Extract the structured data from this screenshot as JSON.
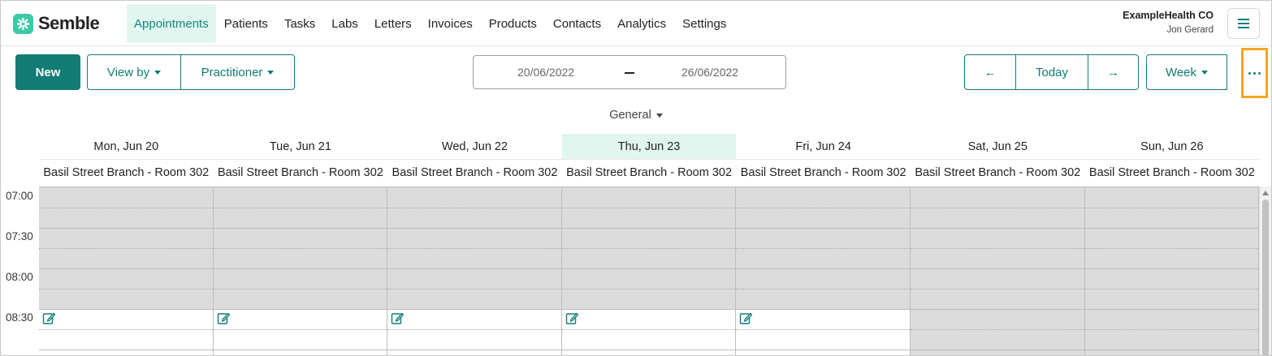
{
  "app": {
    "logo_text": "Semble",
    "brand_color": "#127c74",
    "accent_mint": "#3ec9a7",
    "highlight_color": "#f5a623"
  },
  "nav": {
    "items": [
      {
        "label": "Appointments",
        "active": true
      },
      {
        "label": "Patients"
      },
      {
        "label": "Tasks"
      },
      {
        "label": "Labs"
      },
      {
        "label": "Letters"
      },
      {
        "label": "Invoices"
      },
      {
        "label": "Products"
      },
      {
        "label": "Contacts"
      },
      {
        "label": "Analytics"
      },
      {
        "label": "Settings"
      }
    ],
    "org_name": "ExampleHealth CO",
    "user_name": "Jon Gerard",
    "menu_icon": "hamburger-icon"
  },
  "toolbar": {
    "new_label": "New",
    "view_by_label": "View by",
    "practitioner_label": "Practitioner",
    "date_from": "20/06/2022",
    "date_to": "26/06/2022",
    "prev_label": "←",
    "today_label": "Today",
    "next_label": "→",
    "range_label": "Week",
    "more_icon": "more-horizontal-icon"
  },
  "calendar": {
    "resource_filter": "General",
    "days": [
      {
        "name": "Mon, Jun 20",
        "resource": "Basil Street Branch - Room 302",
        "today": false,
        "working": true
      },
      {
        "name": "Tue, Jun 21",
        "resource": "Basil Street Branch - Room 302",
        "today": false,
        "working": true
      },
      {
        "name": "Wed, Jun 22",
        "resource": "Basil Street Branch - Room 302",
        "today": false,
        "working": true
      },
      {
        "name": "Thu, Jun 23",
        "resource": "Basil Street Branch - Room 302",
        "today": true,
        "working": true
      },
      {
        "name": "Fri, Jun 24",
        "resource": "Basil Street Branch - Room 302",
        "today": false,
        "working": true
      },
      {
        "name": "Sat, Jun 25",
        "resource": "Basil Street Branch - Room 302",
        "today": false,
        "working": false
      },
      {
        "name": "Sun, Jun 26",
        "resource": "Basil Street Branch - Room 302",
        "today": false,
        "working": false
      }
    ],
    "times": [
      "07:00",
      "07:30",
      "08:00",
      "08:30"
    ],
    "opening_time": "08:30",
    "edit_icon": "edit-icon"
  }
}
